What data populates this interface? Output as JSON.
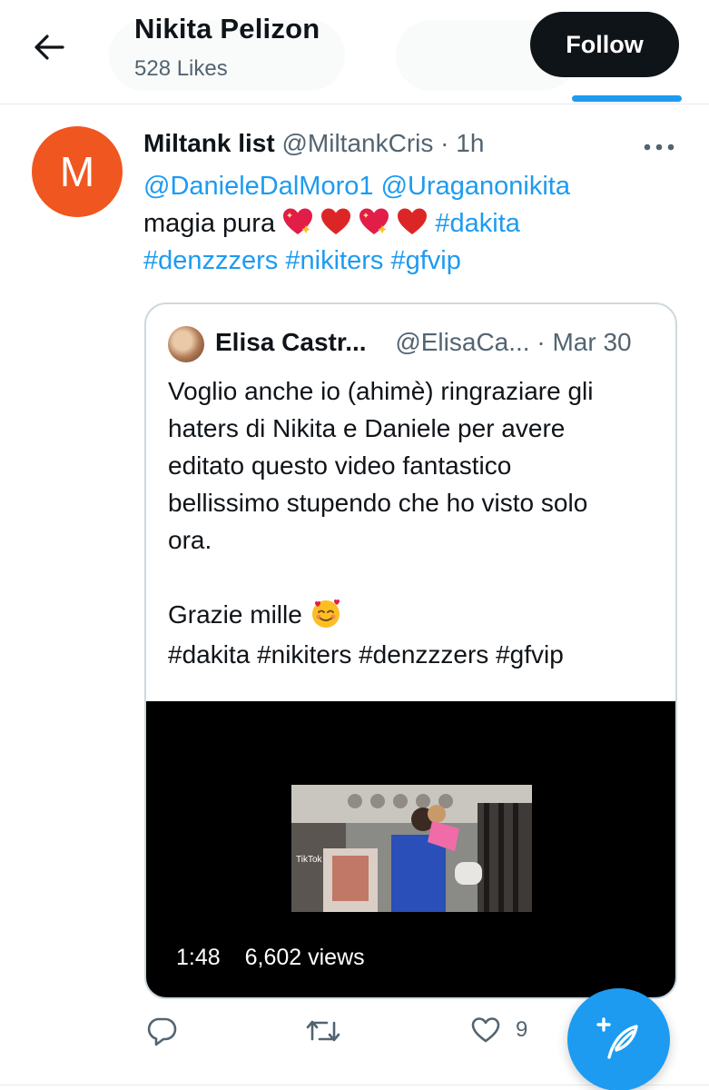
{
  "header": {
    "back_label": "Back",
    "title": "Nikita Pelizon",
    "subtitle": "528 Likes",
    "follow_label": "Follow"
  },
  "tweet": {
    "avatar_letter": "M",
    "avatar_color": "#f0561f",
    "name": "Miltank list",
    "handle": "@MiltankCris",
    "separator": "·",
    "time": "1h",
    "mention_1": "@DanieleDalMoro1",
    "mention_2": "@Uraganonikita",
    "text": "magia pura",
    "hashtag_1": "#dakita",
    "hashtag_2": "#denzzzers",
    "hashtag_3": "#nikiters",
    "hashtag_4": "#gfvip",
    "heart_icons": [
      "sparkling-heart-icon",
      "red-heart-icon",
      "sparkling-heart-icon",
      "red-heart-icon"
    ]
  },
  "quote": {
    "name": "Elisa Castr...",
    "handle": "@ElisaCa...",
    "separator": "·",
    "time": "Mar 30",
    "body": "Voglio anche io (ahimè) ringraziare gli\nhaters di Nikita e Daniele per avere\neditato questo video fantastico\nbellissimo stupendo che ho visto solo\nora.\n\nGrazie mille",
    "emoji_icon": "smiling-face-with-hearts-icon",
    "tags": "#dakita #nikiters #denzzzers #gfvip",
    "video": {
      "duration": "1:48",
      "views": "6,602 views"
    }
  },
  "actions": {
    "reply_count": "",
    "retweet_count": "",
    "like_count": "9"
  },
  "colors": {
    "accent": "#1d9bf0",
    "text": "#0f1419",
    "muted": "#536471",
    "border": "#cfd9de"
  }
}
